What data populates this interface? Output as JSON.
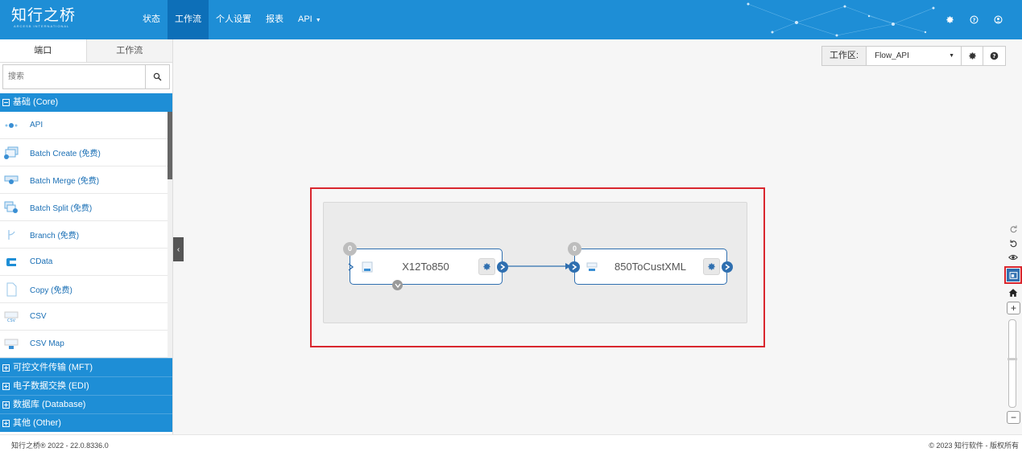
{
  "brand": {
    "logo_text": "知行之桥",
    "logo_sub": "ARCESB INTERNATIONAL"
  },
  "nav": {
    "items": [
      {
        "label": "状态"
      },
      {
        "label": "工作流"
      },
      {
        "label": "个人设置"
      },
      {
        "label": "报表"
      },
      {
        "label": "API"
      }
    ],
    "active_index": 1,
    "right_icons": [
      "gear-icon",
      "help-icon",
      "user-icon"
    ]
  },
  "sidebar": {
    "tabs": [
      {
        "label": "端口"
      },
      {
        "label": "工作流"
      }
    ],
    "search_placeholder": "搜索",
    "core_group": "基础 (Core)",
    "items": [
      {
        "label": "API",
        "icon": "api-connector-icon"
      },
      {
        "label": "Batch Create (免费)",
        "icon": "batch-create-icon"
      },
      {
        "label": "Batch Merge (免费)",
        "icon": "batch-merge-icon"
      },
      {
        "label": "Batch Split (免费)",
        "icon": "batch-split-icon"
      },
      {
        "label": "Branch (免费)",
        "icon": "branch-icon"
      },
      {
        "label": "CData",
        "icon": "cdata-icon"
      },
      {
        "label": "Copy (免费)",
        "icon": "copy-icon"
      },
      {
        "label": "CSV",
        "icon": "csv-icon"
      },
      {
        "label": "CSV Map",
        "icon": "csv-map-icon"
      }
    ],
    "groups": [
      {
        "label": "可控文件传输 (MFT)"
      },
      {
        "label": "电子数据交换 (EDI)"
      },
      {
        "label": "数据库 (Database)"
      },
      {
        "label": "其他 (Other)"
      }
    ]
  },
  "workspace": {
    "label": "工作区:",
    "selected": "Flow_API"
  },
  "flow": {
    "nodes": [
      {
        "label": "X12To850",
        "count": "0"
      },
      {
        "label": "850ToCustXML",
        "count": "0"
      }
    ]
  },
  "toolbar_right": [
    "redo-icon",
    "undo-icon",
    "eye-icon",
    "minimap-icon",
    "home-icon",
    "zoom-in-icon"
  ],
  "footer": {
    "left": "知行之桥® 2022 - 22.0.8336.0",
    "right": "© 2023 知行软件 - 版权所有"
  },
  "colors": {
    "primary": "#1e8ed6",
    "nav_active": "#0d6fb8",
    "node_border": "#2f6fb0",
    "highlight": "#d9262e"
  }
}
